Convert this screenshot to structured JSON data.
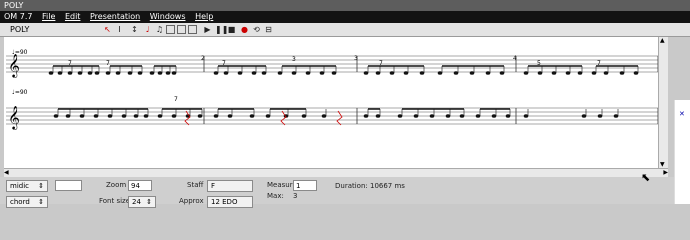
{
  "window": {
    "title": "POLY"
  },
  "menu": {
    "items": [
      "OM 7.7",
      "File",
      "Edit",
      "Presentation",
      "Windows",
      "Help"
    ]
  },
  "toolbar": {
    "label": "POLY"
  },
  "score": {
    "tempo1": "♩=90",
    "tempo2": "♩=90",
    "measures": [
      "2",
      "3",
      "4"
    ],
    "tuplets": [
      "7",
      "7",
      "7",
      "3",
      "7",
      "5",
      "7",
      "7"
    ]
  },
  "bottom": {
    "mode_select": "midic",
    "mode_select2": "chord",
    "zoom_label": "Zoom",
    "zoom_value": "94",
    "fontsize_label": "Font size",
    "fontsize_value": "24",
    "staff_label": "Staff",
    "staff_value": "F",
    "approx_label": "Approx",
    "approx_value": "12 EDO",
    "measure_label": "Measure",
    "measure_value": "1",
    "max_label": "Max:",
    "max_value": "3",
    "duration_text": "Duration: 10667 ms"
  }
}
